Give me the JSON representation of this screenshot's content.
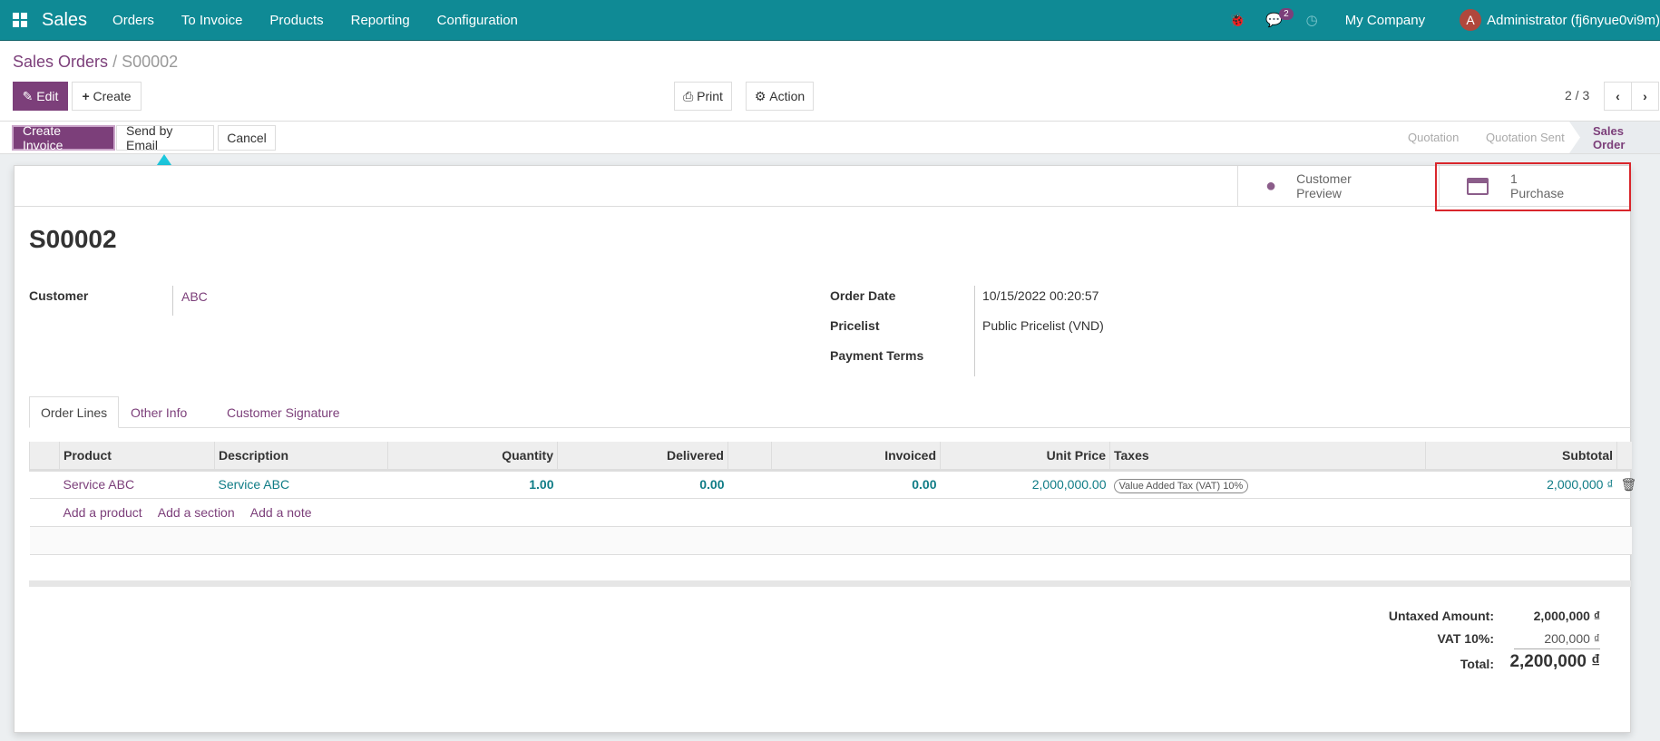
{
  "nav": {
    "app": "Sales",
    "menu": [
      "Orders",
      "To Invoice",
      "Products",
      "Reporting",
      "Configuration"
    ],
    "messages_count": "2",
    "company": "My Company",
    "avatar_letter": "A",
    "user": "Administrator (fj6nyue0vi9m)"
  },
  "breadcrumb": {
    "parent": "Sales Orders",
    "separator": "/",
    "current": "S00002"
  },
  "toolbar": {
    "edit": "Edit",
    "create": "Create",
    "print": "Print",
    "action": "Action",
    "pager": "2 / 3"
  },
  "header_buttons": {
    "create_invoice": "Create Invoice",
    "send_email": "Send by Email",
    "cancel": "Cancel"
  },
  "stages": [
    "Quotation",
    "Quotation Sent",
    "Sales Order"
  ],
  "smart_buttons": {
    "preview_line1": "Customer",
    "preview_line2": "Preview",
    "purchase_count": "1",
    "purchase_label": "Purchase"
  },
  "order": {
    "name": "S00002",
    "customer_label": "Customer",
    "customer": "ABC",
    "order_date_label": "Order Date",
    "order_date": "10/15/2022 00:20:57",
    "pricelist_label": "Pricelist",
    "pricelist": "Public Pricelist (VND)",
    "payment_terms_label": "Payment Terms"
  },
  "tabs": [
    "Order Lines",
    "Other Info",
    "Customer Signature"
  ],
  "table": {
    "headers": [
      "Product",
      "Description",
      "Quantity",
      "Delivered",
      "Invoiced",
      "Unit Price",
      "Taxes",
      "Subtotal"
    ],
    "rows": [
      {
        "product": "Service ABC",
        "description": "Service ABC",
        "quantity": "1.00",
        "delivered": "0.00",
        "invoiced": "0.00",
        "unit_price": "2,000,000.00",
        "tax": "Value Added Tax (VAT) 10%",
        "subtotal": "2,000,000 ₫"
      }
    ],
    "add_links": [
      "Add a product",
      "Add a section",
      "Add a note"
    ]
  },
  "totals": {
    "untaxed_label": "Untaxed Amount:",
    "untaxed": "2,000,000 ₫",
    "vat_label": "VAT 10%:",
    "vat": "200,000 ₫",
    "total_label": "Total:",
    "total": "2,200,000 ₫"
  }
}
